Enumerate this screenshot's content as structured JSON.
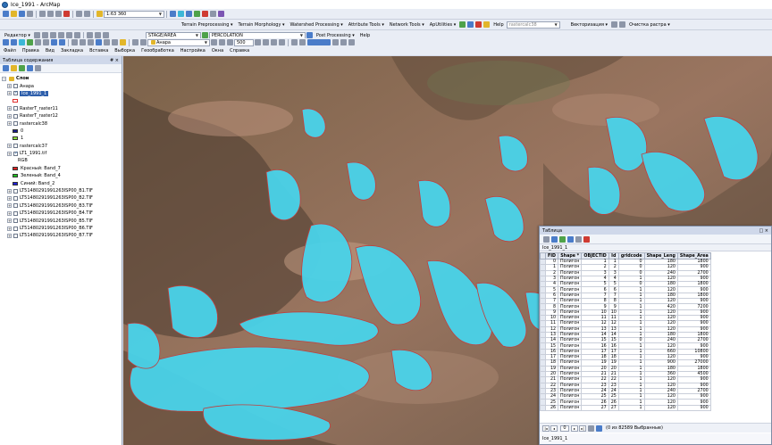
{
  "window": {
    "title": "Ice_1991 - ArcMap"
  },
  "standard_toolbar": {
    "scale": "1:63 360"
  },
  "toolbar2": {
    "items": [
      "Terrain Preprocessing ▾",
      "Terrain Morphology ▾",
      "Watershed Processing ▾",
      "Attribute Tools ▾",
      "Network Tools ▾",
      "ApUtilities ▾"
    ],
    "help": "Help",
    "raster_field": "rastercalc38",
    "vectorize": "Векторизация ▾",
    "raster_clean": "Очистка растра ▾"
  },
  "toolbar3": {
    "editor": "Редактор ▾",
    "stage_dropdown": "STAGE/AREA",
    "percolation_dropdown": "PERCOLATION",
    "post_processing": "Post Processing ▾",
    "help": "Help"
  },
  "toolbar4": {
    "layer_dropdown": "Анара",
    "zoom_value": "500"
  },
  "menu": [
    "Файл",
    "Правка",
    "Вид",
    "Закладка",
    "Вставка",
    "Выборка",
    "Геообработка",
    "Настройка",
    "Окна",
    "Справка"
  ],
  "toc": {
    "title": "Таблица содержания",
    "pin": "# ×",
    "root": "Слои",
    "layers": [
      {
        "label": "Анара",
        "checked": false,
        "indent": 1
      },
      {
        "label": "Ice_1991_1",
        "checked": true,
        "indent": 1,
        "selected": true
      },
      {
        "label": "",
        "swatch": "#ffffff",
        "swatch_border": "#e03030",
        "indent": 2
      },
      {
        "label": "RasterT_raster11",
        "checked": false,
        "indent": 1
      },
      {
        "label": "RasterT_raster12",
        "checked": false,
        "indent": 1
      },
      {
        "label": "rastercalc38",
        "checked": false,
        "indent": 1
      },
      {
        "label": "0",
        "swatch": "#1a1a8c",
        "indent": 2
      },
      {
        "label": "1",
        "swatch": "#8ede3c",
        "indent": 2
      },
      {
        "label": "rastercalc37",
        "checked": false,
        "indent": 1
      },
      {
        "label": "LT1_1991.tif",
        "checked": true,
        "indent": 1
      },
      {
        "label": "RGB",
        "indent": 3
      },
      {
        "label": "Красный:  Band_7",
        "swatch": "#e02020",
        "indent": 2
      },
      {
        "label": "Зеленый: Band_4",
        "swatch": "#20c020",
        "indent": 2
      },
      {
        "label": "Синий:  Band_2",
        "swatch": "#2020d8",
        "indent": 2
      },
      {
        "label": "LT51480291991263ISP00_B1.TIF",
        "checked": false,
        "indent": 1
      },
      {
        "label": "LT51480291991263ISP00_B2.TIF",
        "checked": false,
        "indent": 1
      },
      {
        "label": "LT51480291991263ISP00_B3.TIF",
        "checked": false,
        "indent": 1
      },
      {
        "label": "LT51480291991263ISP00_B4.TIF",
        "checked": false,
        "indent": 1
      },
      {
        "label": "LT51480291991263ISP00_B5.TIF",
        "checked": false,
        "indent": 1
      },
      {
        "label": "LT51480291991263ISP00_B6.TIF",
        "checked": false,
        "indent": 1
      },
      {
        "label": "LT51480291991263ISP00_B7.TIF",
        "checked": false,
        "indent": 1
      }
    ]
  },
  "table_window": {
    "title": "Таблица",
    "close": "□ ×",
    "layer_name": "Ice_1991_1",
    "columns": [
      "FID",
      "Shape *",
      "OBJECTID",
      "Id",
      "gridcode",
      "Shape_Leng",
      "Shape_Area"
    ],
    "rows": [
      [
        "0",
        "Полигон",
        "1",
        "1",
        "0",
        "180",
        "1800"
      ],
      [
        "1",
        "Полигон",
        "2",
        "2",
        "0",
        "120",
        "900"
      ],
      [
        "2",
        "Полигон",
        "3",
        "3",
        "0",
        "240",
        "2700"
      ],
      [
        "3",
        "Полигон",
        "4",
        "4",
        "1",
        "120",
        "900"
      ],
      [
        "4",
        "Полигон",
        "5",
        "5",
        "0",
        "180",
        "1800"
      ],
      [
        "5",
        "Полигон",
        "6",
        "6",
        "1",
        "120",
        "900"
      ],
      [
        "6",
        "Полигон",
        "7",
        "7",
        "1",
        "180",
        "1800"
      ],
      [
        "7",
        "Полигон",
        "8",
        "8",
        "1",
        "120",
        "900"
      ],
      [
        "8",
        "Полигон",
        "9",
        "9",
        "1",
        "420",
        "7200"
      ],
      [
        "9",
        "Полигон",
        "10",
        "10",
        "1",
        "120",
        "900"
      ],
      [
        "10",
        "Полигон",
        "11",
        "11",
        "1",
        "120",
        "900"
      ],
      [
        "11",
        "Полигон",
        "12",
        "12",
        "1",
        "120",
        "900"
      ],
      [
        "12",
        "Полигон",
        "13",
        "13",
        "1",
        "120",
        "900"
      ],
      [
        "13",
        "Полигон",
        "14",
        "14",
        "1",
        "180",
        "1800"
      ],
      [
        "14",
        "Полигон",
        "15",
        "15",
        "0",
        "240",
        "2700"
      ],
      [
        "15",
        "Полигон",
        "16",
        "16",
        "1",
        "120",
        "900"
      ],
      [
        "16",
        "Полигон",
        "17",
        "17",
        "1",
        "660",
        "10800"
      ],
      [
        "17",
        "Полигон",
        "18",
        "18",
        "1",
        "120",
        "900"
      ],
      [
        "18",
        "Полигон",
        "19",
        "19",
        "1",
        "900",
        "27000"
      ],
      [
        "19",
        "Полигон",
        "20",
        "20",
        "1",
        "180",
        "1800"
      ],
      [
        "20",
        "Полигон",
        "21",
        "21",
        "1",
        "360",
        "4500"
      ],
      [
        "21",
        "Полигон",
        "22",
        "22",
        "1",
        "120",
        "900"
      ],
      [
        "22",
        "Полигон",
        "23",
        "23",
        "1",
        "120",
        "900"
      ],
      [
        "23",
        "Полигон",
        "24",
        "24",
        "1",
        "240",
        "2700"
      ],
      [
        "24",
        "Полигон",
        "25",
        "25",
        "1",
        "120",
        "900"
      ],
      [
        "25",
        "Полигон",
        "26",
        "26",
        "1",
        "120",
        "900"
      ],
      [
        "26",
        "Полигон",
        "27",
        "27",
        "1",
        "120",
        "900"
      ]
    ],
    "nav": {
      "record": "0",
      "status": "(0 из 82589 Выбранные)"
    },
    "tab": "Ice_1991_1"
  },
  "colors": {
    "ice": "#49d3ea",
    "ice_dark": "#2aa7c4",
    "terrain": "#8a6a54",
    "selection": "#2e5fab"
  }
}
